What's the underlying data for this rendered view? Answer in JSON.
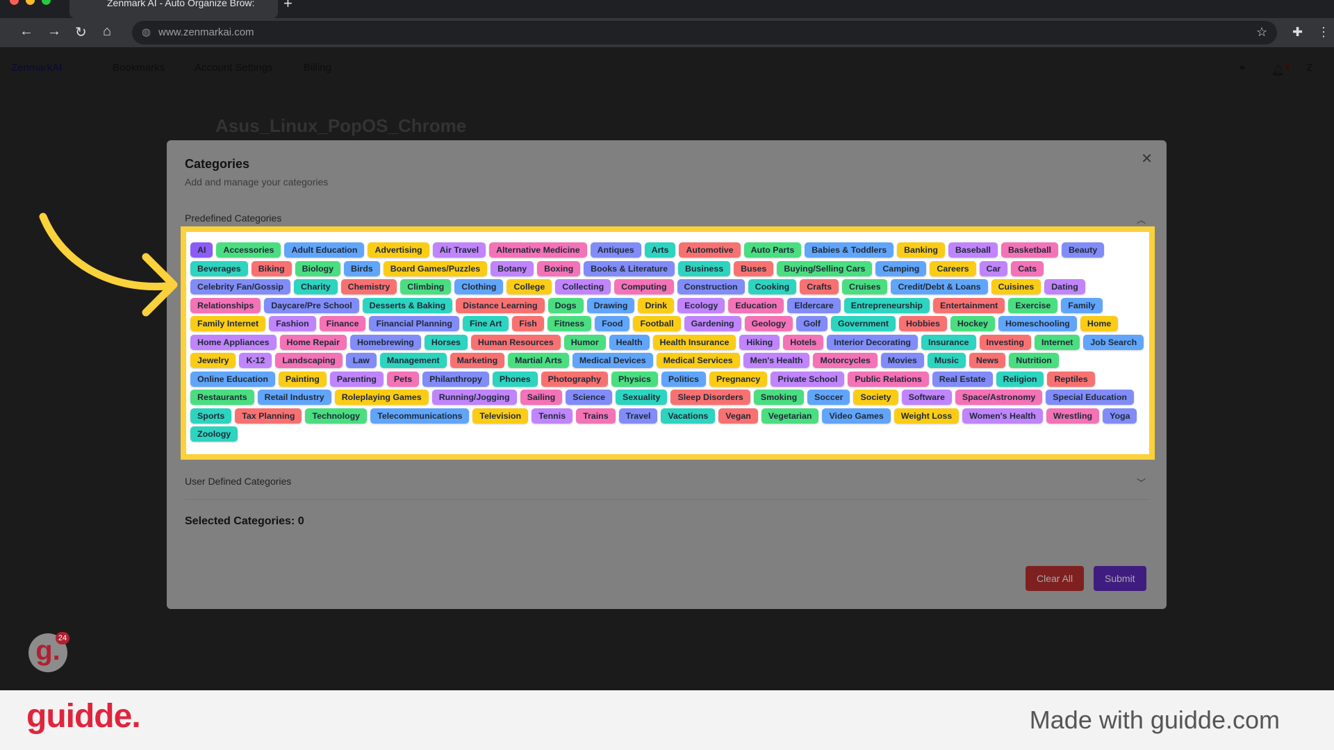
{
  "browser": {
    "tab_title": "Zenmark AI - Auto Organize Brow:",
    "url": "www.zenmarkai.com"
  },
  "app_nav": {
    "logo": "ZenmarkAI",
    "items": [
      "Bookmarks",
      "Account Settings",
      "Billing"
    ],
    "notification_count": "3",
    "user_initial": "Z"
  },
  "page_title": "Asus_Linux_PopOS_Chrome",
  "modal": {
    "title": "Categories",
    "subtitle": "Add and manage your categories",
    "predefined_label": "Predefined Categories",
    "user_defined_label": "User Defined Categories",
    "selected_label": "Selected Categories: 0",
    "clear_label": "Clear All",
    "submit_label": "Submit",
    "selected_tag": "AI",
    "tag_colors": [
      "#4ade80",
      "#60a5fa",
      "#facc15",
      "#c084fc",
      "#f472b6",
      "#818cf8",
      "#2dd4bf",
      "#f87171"
    ],
    "selected_color": "#8b5cf6",
    "tags": [
      "Accessories",
      "Adult Education",
      "Advertising",
      "Air Travel",
      "Alternative Medicine",
      "Antiques",
      "Arts",
      "Automotive",
      "Auto Parts",
      "Babies & Toddlers",
      "Banking",
      "Baseball",
      "Basketball",
      "Beauty",
      "Beverages",
      "Biking",
      "Biology",
      "Birds",
      "Board Games/Puzzles",
      "Botany",
      "Boxing",
      "Books & Literature",
      "Business",
      "Buses",
      "Buying/Selling Cars",
      "Camping",
      "Careers",
      "Car",
      "Cats",
      "Celebrity Fan/Gossip",
      "Charity",
      "Chemistry",
      "Climbing",
      "Clothing",
      "College",
      "Collecting",
      "Computing",
      "Construction",
      "Cooking",
      "Crafts",
      "Cruises",
      "Credit/Debt & Loans",
      "Cuisines",
      "Dating",
      "Relationships",
      "Daycare/Pre School",
      "Desserts & Baking",
      "Distance Learning",
      "Dogs",
      "Drawing",
      "Drink",
      "Ecology",
      "Education",
      "Eldercare",
      "Entrepreneurship",
      "Entertainment",
      "Exercise",
      "Family",
      "Family Internet",
      "Fashion",
      "Finance",
      "Financial Planning",
      "Fine Art",
      "Fish",
      "Fitness",
      "Food",
      "Football",
      "Gardening",
      "Geology",
      "Golf",
      "Government",
      "Hobbies",
      "Hockey",
      "Homeschooling",
      "Home",
      "Home Appliances",
      "Home Repair",
      "Homebrewing",
      "Horses",
      "Human Resources",
      "Humor",
      "Health",
      "Health Insurance",
      "Hiking",
      "Hotels",
      "Interior Decorating",
      "Insurance",
      "Investing",
      "Internet",
      "Job Search",
      "Jewelry",
      "K-12",
      "Landscaping",
      "Law",
      "Management",
      "Marketing",
      "Martial Arts",
      "Medical Devices",
      "Medical Services",
      "Men's Health",
      "Motorcycles",
      "Movies",
      "Music",
      "News",
      "Nutrition",
      "Online Education",
      "Painting",
      "Parenting",
      "Pets",
      "Philanthropy",
      "Phones",
      "Photography",
      "Physics",
      "Politics",
      "Pregnancy",
      "Private School",
      "Public Relations",
      "Real Estate",
      "Religion",
      "Reptiles",
      "Restaurants",
      "Retail Industry",
      "Roleplaying Games",
      "Running/Jogging",
      "Sailing",
      "Science",
      "Sexuality",
      "Sleep Disorders",
      "Smoking",
      "Soccer",
      "Society",
      "Software",
      "Space/Astronomy",
      "Special Education",
      "Sports",
      "Tax Planning",
      "Technology",
      "Telecommunications",
      "Television",
      "Tennis",
      "Trains",
      "Travel",
      "Vacations",
      "Vegan",
      "Vegetarian",
      "Video Games",
      "Weight Loss",
      "Women's Health",
      "Wrestling",
      "Yoga",
      "Zoology"
    ]
  },
  "guidde": {
    "avatar_letter": "g.",
    "badge": "24",
    "logo": "guidde.",
    "made_with": "Made with guidde.com"
  },
  "highlight_color": "#fbd13c"
}
